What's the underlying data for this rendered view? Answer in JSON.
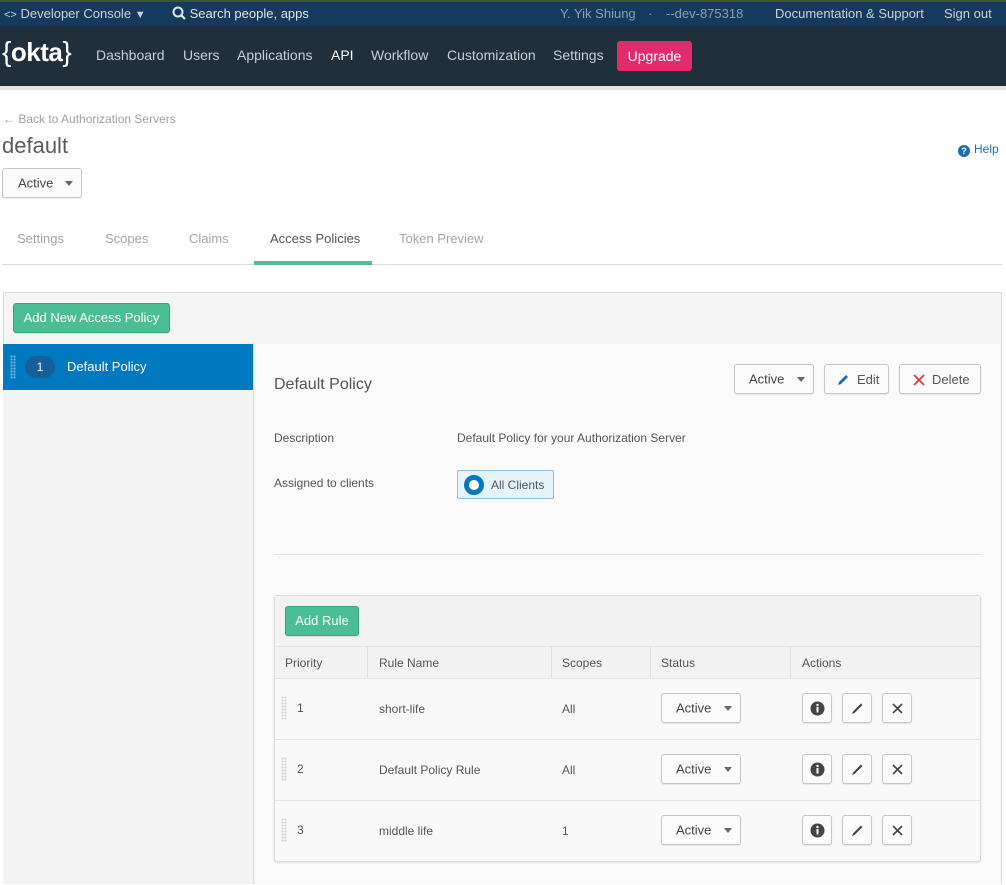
{
  "topbar": {
    "console_label": "Developer Console",
    "search_placeholder": "Search people, apps",
    "user_name": "Y. Yik Shiung",
    "separator": "·",
    "org": "--dev-875318",
    "docs_link": "Documentation & Support",
    "signout_link": "Sign out"
  },
  "nav": {
    "logo": "okta",
    "items": [
      "Dashboard",
      "Users",
      "Applications",
      "API",
      "Workflow",
      "Customization",
      "Settings"
    ],
    "active": "API",
    "upgrade_label": "Upgrade"
  },
  "page": {
    "back_link": "← Back to Authorization Servers",
    "title": "default",
    "status": "Active",
    "help_label": "Help"
  },
  "tabs": [
    {
      "label": "Settings"
    },
    {
      "label": "Scopes"
    },
    {
      "label": "Claims"
    },
    {
      "label": "Access Policies",
      "active": true
    },
    {
      "label": "Token Preview"
    }
  ],
  "policies": {
    "add_button": "Add New Access Policy",
    "items": [
      {
        "priority": "1",
        "name": "Default Policy",
        "selected": true
      }
    ]
  },
  "policy_detail": {
    "title": "Default Policy",
    "status": "Active",
    "edit_label": "Edit",
    "delete_label": "Delete",
    "description_label": "Description",
    "description_value": "Default Policy for your Authorization Server",
    "assigned_label": "Assigned to clients",
    "assigned_value": "All Clients"
  },
  "rules": {
    "add_button": "Add Rule",
    "columns": [
      "Priority",
      "Rule Name",
      "Scopes",
      "Status",
      "Actions"
    ],
    "rows": [
      {
        "priority": "1",
        "name": "short-life",
        "scopes": "All",
        "status": "Active"
      },
      {
        "priority": "2",
        "name": "Default Policy Rule",
        "scopes": "All",
        "status": "Active"
      },
      {
        "priority": "3",
        "name": "middle life",
        "scopes": "1",
        "status": "Active"
      }
    ]
  },
  "colors": {
    "topbar": "#153a5b",
    "nav": "#1f2f3b",
    "upgrade": "#e22b6a",
    "accent_green": "#4cbe96",
    "selected_blue": "#0079c1",
    "delete_red": "#e03a3a",
    "edit_blue": "#1a6db5"
  }
}
